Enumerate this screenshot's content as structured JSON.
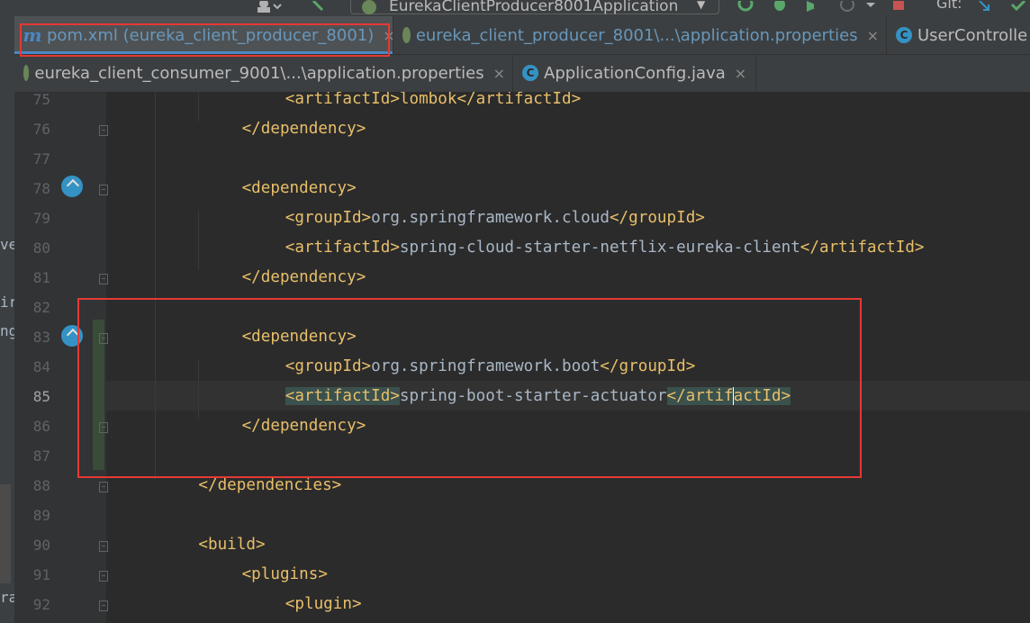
{
  "toolbar": {
    "run_config": "EurekaClientProducer8001Application",
    "git_label": "Git:"
  },
  "tabs": {
    "row1": [
      {
        "label": "pom.xml (eureka_client_producer_8001)",
        "icon": "maven-icon",
        "active": true
      },
      {
        "label": "eureka_client_producer_8001\\...\\application.properties",
        "icon": "spring-icon"
      },
      {
        "label": "UserControlle",
        "icon": "java-class-icon"
      }
    ],
    "row2": [
      {
        "label": "eureka_client_consumer_9001\\...\\application.properties",
        "icon": "spring-icon"
      },
      {
        "label": "ApplicationConfig.java",
        "icon": "java-class-icon"
      }
    ],
    "close_glyph": "×"
  },
  "left_strip_fragments": [
    "ve",
    "ir",
    "ng",
    "ra"
  ],
  "editor": {
    "current_line": 85,
    "lines": [
      {
        "n": "75",
        "text": "<artifactId>lombok</artifactId>"
      },
      {
        "n": "76",
        "text": "</dependency>"
      },
      {
        "n": "77",
        "text": ""
      },
      {
        "n": "78",
        "text": "<dependency>"
      },
      {
        "n": "79",
        "open": "<groupId>",
        "value": "org.springframework.cloud",
        "close": "</groupId>"
      },
      {
        "n": "80",
        "open": "<artifactId>",
        "value": "spring-cloud-starter-netflix-eureka-client",
        "close": "</artifactId>"
      },
      {
        "n": "81",
        "text": "</dependency>"
      },
      {
        "n": "82",
        "text": ""
      },
      {
        "n": "83",
        "text": "<dependency>"
      },
      {
        "n": "84",
        "open": "<groupId>",
        "value": "org.springframework.boot",
        "close": "</groupId>"
      },
      {
        "n": "85",
        "open": "<artifactId>",
        "value": "spring-boot-starter-actuator",
        "close_a": "</artif",
        "close_b": "actId>"
      },
      {
        "n": "86",
        "text": "</dependency>"
      },
      {
        "n": "87",
        "text": ""
      },
      {
        "n": "88",
        "text": "</dependencies>"
      },
      {
        "n": "89",
        "text": ""
      },
      {
        "n": "90",
        "text": "<build>"
      },
      {
        "n": "91",
        "text": "<plugins>"
      },
      {
        "n": "92",
        "text": "<plugin>"
      }
    ]
  },
  "colors": {
    "tag": "#e8bf6a",
    "text": "#a9b7c6",
    "line_number": "#606366",
    "highlight_box": "#e53935",
    "active_tab_underline": "#4a88c7"
  }
}
